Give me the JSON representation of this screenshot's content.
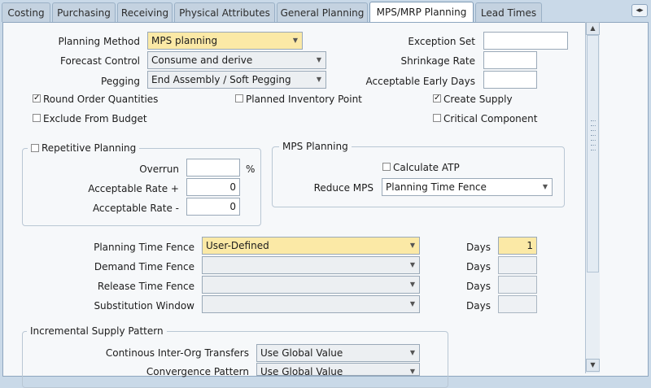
{
  "tabs": [
    {
      "label": "Costing",
      "active": false
    },
    {
      "label": "Purchasing",
      "active": false
    },
    {
      "label": "Receiving",
      "active": false
    },
    {
      "label": "Physical Attributes",
      "active": false
    },
    {
      "label": "General Planning",
      "active": false
    },
    {
      "label": "MPS/MRP Planning",
      "active": true
    },
    {
      "label": "Lead Times",
      "active": false
    }
  ],
  "nav_button": "◂▸",
  "fields": {
    "planning_method": {
      "label": "Planning Method",
      "value": "MPS planning"
    },
    "forecast_control": {
      "label": "Forecast Control",
      "value": "Consume and derive"
    },
    "pegging": {
      "label": "Pegging",
      "value": "End Assembly / Soft Pegging"
    },
    "exception_set": {
      "label": "Exception Set",
      "value": ""
    },
    "shrinkage_rate": {
      "label": "Shrinkage Rate",
      "value": ""
    },
    "acceptable_early_days": {
      "label": "Acceptable Early Days",
      "value": ""
    }
  },
  "checkboxes": {
    "round_order_quantities": {
      "label": "Round Order Quantities",
      "checked": true
    },
    "exclude_from_budget": {
      "label": "Exclude From Budget",
      "checked": false
    },
    "planned_inventory_point": {
      "label": "Planned Inventory Point",
      "checked": false
    },
    "create_supply": {
      "label": "Create Supply",
      "checked": true
    },
    "critical_component": {
      "label": "Critical Component",
      "checked": false
    }
  },
  "repetitive_planning": {
    "label": "Repetitive Planning",
    "checked": false,
    "overrun": {
      "label": "Overrun",
      "value": "",
      "unit": "%"
    },
    "acceptable_rate_plus": {
      "label": "Acceptable Rate +",
      "value": "0"
    },
    "acceptable_rate_minus": {
      "label": "Acceptable Rate -",
      "value": "0"
    }
  },
  "mps_planning": {
    "title": "MPS Planning",
    "calculate_atp": {
      "label": "Calculate ATP",
      "checked": false
    },
    "reduce_mps": {
      "label": "Reduce MPS",
      "value": "Planning Time Fence"
    }
  },
  "time_fences": [
    {
      "label": "Planning Time Fence",
      "value": "User-Defined",
      "days_label": "Days",
      "days": "1"
    },
    {
      "label": "Demand Time Fence",
      "value": "",
      "days_label": "Days",
      "days": ""
    },
    {
      "label": "Release Time Fence",
      "value": "",
      "days_label": "Days",
      "days": ""
    },
    {
      "label": "Substitution Window",
      "value": "",
      "days_label": "Days",
      "days": ""
    }
  ],
  "incremental_supply": {
    "title": "Incremental Supply Pattern",
    "continuous_transfers": {
      "label": "Continous Inter-Org Transfers",
      "value": "Use Global Value"
    },
    "convergence_pattern": {
      "label": "Convergence Pattern",
      "value": "Use Global Value"
    }
  },
  "icons": {
    "dropdown": "▼",
    "scroll_up": "▲",
    "scroll_down": "▼",
    "check": "✓"
  },
  "colors": {
    "required_field": "#fbe9a6",
    "background": "#c9d9e8",
    "panel": "#f6f8fa"
  }
}
